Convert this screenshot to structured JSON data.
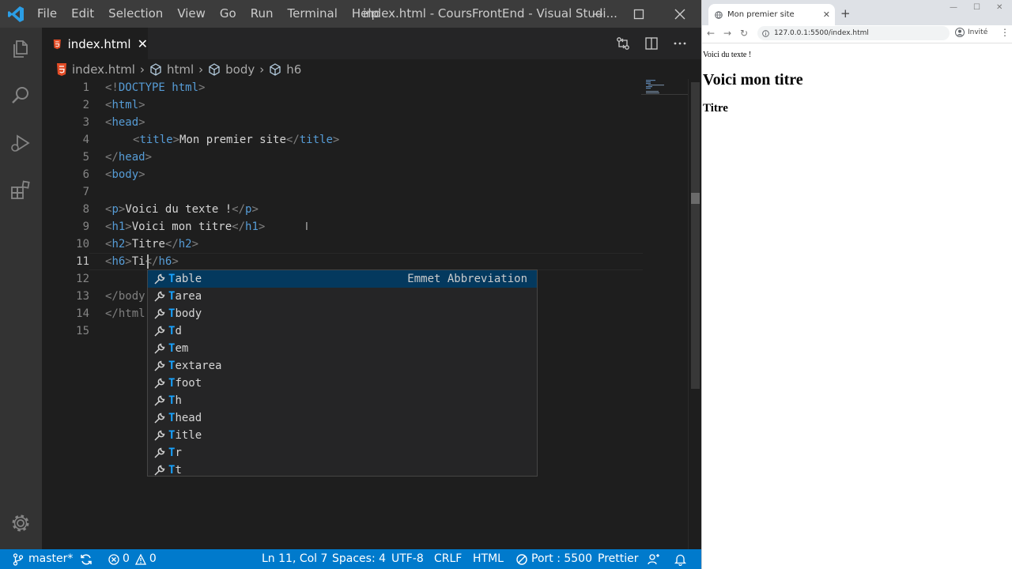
{
  "vscode": {
    "menu": [
      "File",
      "Edit",
      "Selection",
      "View",
      "Go",
      "Run",
      "Terminal",
      "Help"
    ],
    "window_title": "index.html - CoursFrontEnd - Visual Studi...",
    "tab": {
      "name": "index.html",
      "close": "✕"
    },
    "breadcrumb": [
      "index.html",
      "html",
      "body",
      "h6"
    ],
    "line_numbers": [
      "1",
      "2",
      "3",
      "4",
      "5",
      "6",
      "7",
      "8",
      "9",
      "10",
      "11",
      "12",
      "13",
      "14",
      "15"
    ],
    "code": {
      "l1_open": "<!",
      "l1_kw": "DOCTYPE",
      "l1_html": " html",
      "l1_close": ">",
      "html": "html",
      "head": "head",
      "title": "title",
      "title_text": "Mon premier site",
      "body": "body",
      "p": "p",
      "p_text": "Voici du texte !",
      "h1": "h1",
      "h1_text": "Voici mon titre",
      "h2": "h2",
      "h2_text": "Titre",
      "h6": "h6",
      "h6_text": "Ti",
      "l13": "</body",
      "l14": "</html"
    },
    "suggestions": [
      {
        "hl": "T",
        "rest": "able",
        "detail": "Emmet Abbreviation"
      },
      {
        "hl": "T",
        "rest": "area"
      },
      {
        "hl": "T",
        "rest": "body"
      },
      {
        "hl": "T",
        "rest": "d"
      },
      {
        "hl": "T",
        "rest": "em"
      },
      {
        "hl": "T",
        "rest": "extarea"
      },
      {
        "hl": "T",
        "rest": "foot"
      },
      {
        "hl": "T",
        "rest": "h"
      },
      {
        "hl": "T",
        "rest": "head"
      },
      {
        "hl": "T",
        "rest": "itle"
      },
      {
        "hl": "T",
        "rest": "r"
      },
      {
        "hl": "T",
        "rest": "t"
      }
    ],
    "status": {
      "branch": "master*",
      "errors": "0",
      "warnings": "0",
      "position": "Ln 11, Col 7",
      "spaces": "Spaces: 4",
      "encoding": "UTF-8",
      "eol": "CRLF",
      "language": "HTML",
      "port": "Port : 5500",
      "formatter": "Prettier"
    },
    "colors": {
      "accent": "#007acc",
      "tag": "#569cd6",
      "match": "#18a3ff"
    }
  },
  "browser": {
    "tab_title": "Mon premier site",
    "url": "127.0.0.1:5500/index.html",
    "profile": "Invité",
    "content": {
      "p": "Voici du texte !",
      "h1": "Voici mon titre",
      "h2": "Titre"
    }
  }
}
